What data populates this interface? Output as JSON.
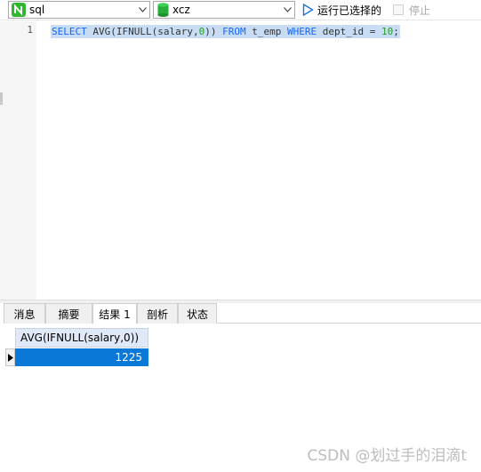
{
  "toolbar": {
    "connection": "sql",
    "database": "xcz",
    "run_selected_label": "运行已选择的",
    "stop_label": "停止"
  },
  "editor": {
    "line_number": "1",
    "tokens": {
      "select": "SELECT",
      "func": "AVG(IFNULL(salary,",
      "zero": "0",
      "close": "))",
      "from": "FROM",
      "table": "t_emp",
      "where": "WHERE",
      "column": "dept_id =",
      "ten": "10",
      "semicolon": ";"
    }
  },
  "tabs": [
    "消息",
    "摘要",
    "结果 1",
    "剖析",
    "状态"
  ],
  "active_tab": "结果 1",
  "result": {
    "column_header": "AVG(IFNULL(salary,0))",
    "rows": [
      [
        "1225"
      ]
    ]
  },
  "watermark": "CSDN @划过手的泪滴t",
  "colors": {
    "keyword": "#1565ff",
    "number": "#20a020",
    "selection": "#c8dcf4",
    "selected_cell": "#0a78d7",
    "header_bg": "#dfe9f7"
  }
}
